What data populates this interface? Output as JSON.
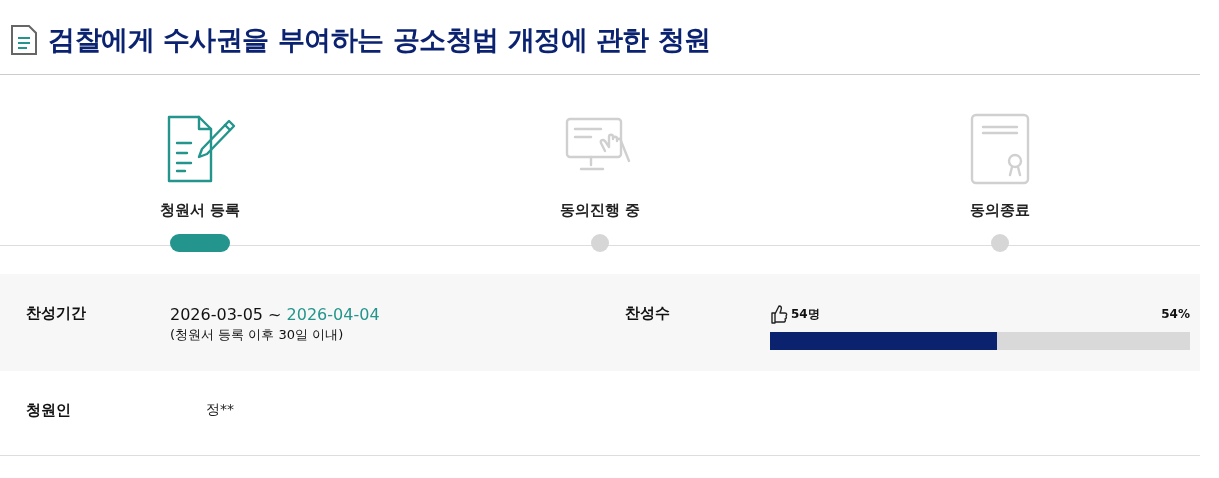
{
  "title": "검찰에게 수사권을 부여하는 공소청법 개정에 관한 청원",
  "steps": [
    {
      "kind": "write",
      "label": "청원서 등록",
      "selected": true
    },
    {
      "kind": "screen",
      "label": "동의진행 중",
      "selected": false
    },
    {
      "kind": "certificate",
      "label": "동의종료",
      "selected": false
    }
  ],
  "period": {
    "label": "찬성기간",
    "start": "2026-03-05 ~",
    "end": "2026-04-04",
    "note": "(청원서 등록 이후 30일 이내)"
  },
  "support": {
    "label": "찬성수",
    "count": "54명",
    "percent": "54%",
    "level": 0.54
  },
  "petitioner": {
    "label": "청원인",
    "value": "정**"
  }
}
